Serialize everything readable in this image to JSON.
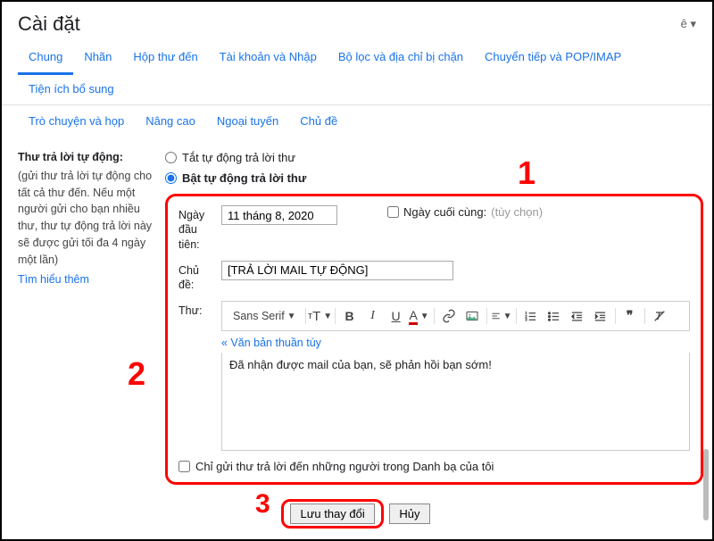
{
  "header": {
    "title": "Cài đặt",
    "cog": "ê  ▾"
  },
  "tabs": {
    "row1": [
      "Chung",
      "Nhãn",
      "Hộp thư đến",
      "Tài khoản và Nhập",
      "Bộ lọc và địa chỉ bị chặn",
      "Chuyển tiếp và POP/IMAP",
      "Tiện ích bổ sung"
    ],
    "row2": [
      "Trò chuyện và họp",
      "Nâng cao",
      "Ngoại tuyến",
      "Chủ đề"
    ]
  },
  "side": {
    "title": "Thư trả lời tự động:",
    "desc": "(gửi thư trả lời tự động cho tất cả thư đến. Nếu một người gửi cho bạn nhiều thư, thư tự động trả lời này sẽ được gửi tối đa 4 ngày một lần)",
    "link": "Tìm hiểu thêm"
  },
  "radios": {
    "off": "Tắt tự động trả lời thư",
    "on": "Bật tự động trả lời thư"
  },
  "form": {
    "first_day_label": "Ngày đầu tiên:",
    "first_day_value": "11 tháng 8, 2020",
    "last_day_label": "Ngày cuối cùng:",
    "last_day_placeholder": "(tùy chọn)",
    "subject_label": "Chủ đề:",
    "subject_value": "[TRẢ LỜI MAIL TỰ ĐỘNG]",
    "body_label": "Thư:",
    "font_label": "Sans Serif",
    "plain_text": "« Văn bản thuần túy",
    "body_text": "Đã nhận được mail của bạn, sẽ phản hồi bạn sớm!",
    "contacts_only": "Chỉ gửi thư trả lời đến những người trong Danh bạ của tôi"
  },
  "actions": {
    "save": "Lưu thay đổi",
    "cancel": "Hủy"
  },
  "annot": {
    "a1": "1",
    "a2": "2",
    "a3": "3"
  }
}
